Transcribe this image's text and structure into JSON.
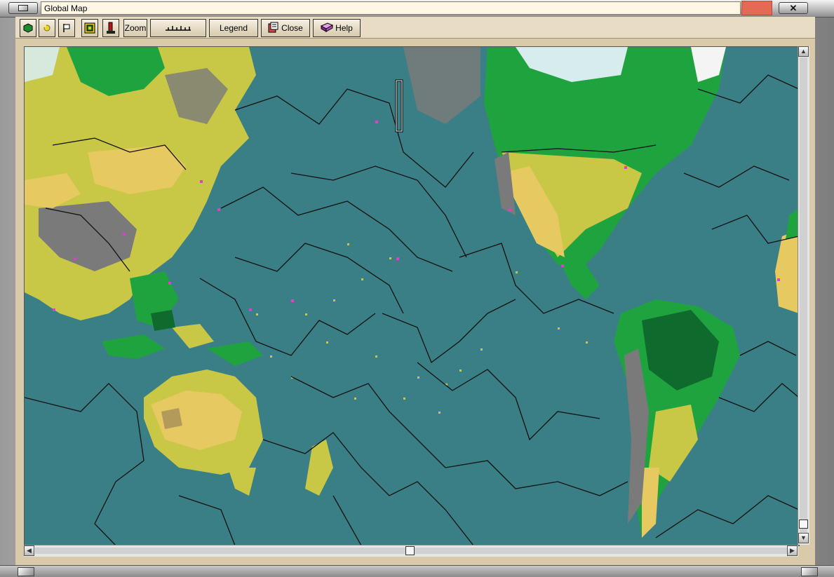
{
  "window": {
    "title": "Global Map"
  },
  "toolbar": {
    "zoom_label": "Zoom",
    "legend_label": "Legend",
    "close_label": "Close",
    "help_label": "Help",
    "tools": [
      {
        "name": "cities-tool-icon",
        "color": "#1c8a2e"
      },
      {
        "name": "resources-tool-icon",
        "color": "#d8c63c"
      },
      {
        "name": "flag-tool-icon",
        "color": "#ffffff"
      },
      {
        "name": "terrain-tool-icon",
        "color": "#c7b222"
      },
      {
        "name": "unit-tool-icon",
        "color": "#a31616"
      }
    ]
  },
  "map": {
    "colors": {
      "ocean": "#3b7f86",
      "grassland": "#c9c846",
      "forest": "#1fa33f",
      "jungle": "#0f6a2d",
      "desert": "#e6c961",
      "mountains": "#7a7a7a",
      "tundra": "#d7ecec",
      "ice": "#f4f4f4",
      "border": "#111111",
      "city": "#e040c8"
    }
  }
}
